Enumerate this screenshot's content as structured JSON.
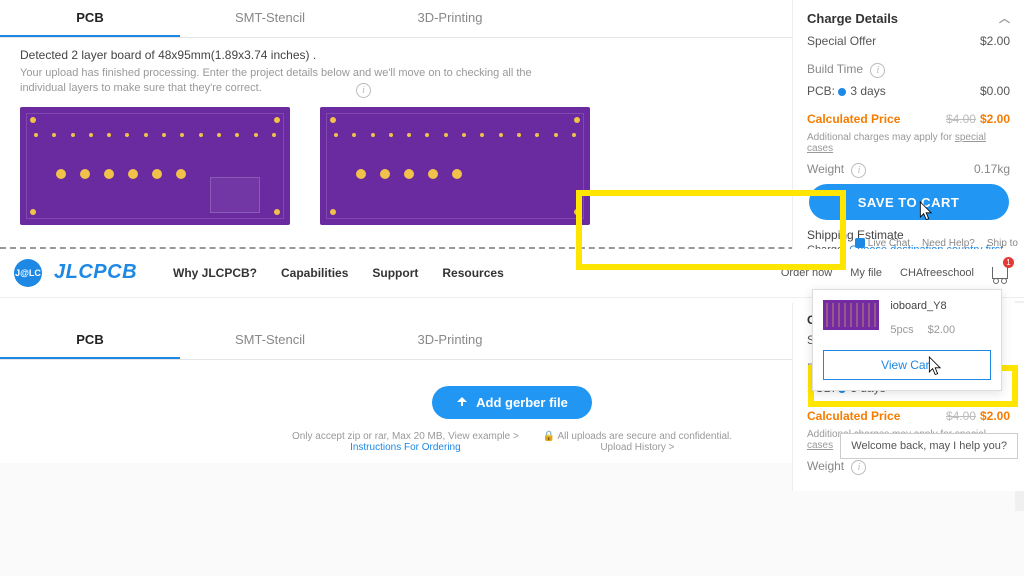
{
  "tabs": {
    "pcb": "PCB",
    "stencil": "SMT-Stencil",
    "print": "3D-Printing"
  },
  "top": {
    "detected": "Detected 2 layer board of 48x95mm(1.89x3.74 inches) .",
    "processing_note": "Your upload has finished processing. Enter the project details below and we'll move on to checking all the individual layers to make sure that they're correct."
  },
  "charge": {
    "title": "Charge Details",
    "special_label": "Special Offer",
    "special_value": "$2.00",
    "build_label": "Build Time",
    "pcb_label": "PCB:",
    "pcb_days": "3 days",
    "pcb_price": "$0.00",
    "calc_label": "Calculated Price",
    "calc_old": "$4.00",
    "calc_new": "$2.00",
    "fine_prefix": "Additional charges may apply for ",
    "fine_link": "special cases",
    "weight_label": "Weight",
    "weight_value": "0.17kg",
    "save_btn": "SAVE TO CART",
    "shipping_label": "Shipping Estimate",
    "charge_prefix": "Charge: ",
    "dest": "Choose destination country first"
  },
  "toolbar": {
    "live": "Live Chat",
    "help": "Need Help?",
    "ship": "Ship to"
  },
  "header": {
    "logo": "JLCPCB",
    "why": "Why JLCPCB?",
    "cap": "Capabilities",
    "sup": "Support",
    "res": "Resources",
    "order": "Order now",
    "myfile": "My file",
    "user": "CHAfreeschool",
    "cart_badge": "1"
  },
  "upload": {
    "btn": "Add gerber file",
    "accept": "Only accept zip or rar, Max 20 MB, View example >",
    "instructions": "Instructions For Ordering",
    "secure": "All uploads are secure and confidential.",
    "history": "Upload History >"
  },
  "dropdown": {
    "name": "ioboard_Y8",
    "qty": "5pcs",
    "price": "$2.00",
    "view": "View Cart"
  },
  "chat": "Welcome back, may I help you?"
}
